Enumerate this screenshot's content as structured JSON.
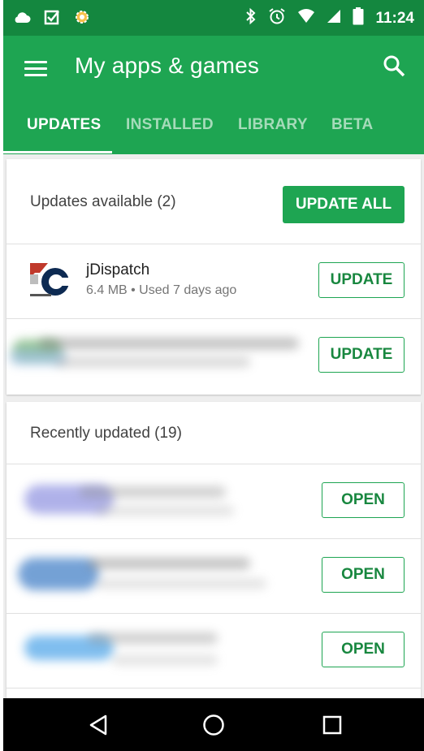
{
  "status_bar": {
    "time": "11:24",
    "battery_level": "90",
    "left_icons": [
      "cloud-icon",
      "checkbox-icon",
      "tasker-icon"
    ],
    "right_icons": [
      "bluetooth-icon",
      "alarm-icon",
      "wifi-icon",
      "signal-icon",
      "battery-icon"
    ]
  },
  "app_bar": {
    "title": "My apps & games",
    "menu_icon": "menu-icon",
    "search_icon": "search-icon",
    "color": "#1ea552",
    "status_color": "#14873f"
  },
  "tabs": [
    {
      "label": "UPDATES",
      "active": true
    },
    {
      "label": "INSTALLED",
      "active": false
    },
    {
      "label": "LIBRARY",
      "active": false
    },
    {
      "label": "BETA",
      "active": false
    }
  ],
  "updates_card": {
    "title": "Updates available (2)",
    "update_all_label": "UPDATE ALL",
    "apps": [
      {
        "name": "jDispatch",
        "meta": "6.4 MB • Used 7 days ago",
        "button": "UPDATE"
      },
      {
        "name": "",
        "meta": "",
        "button": "UPDATE"
      }
    ]
  },
  "recent_card": {
    "title": "Recently updated (19)",
    "apps": [
      {
        "button": "OPEN"
      },
      {
        "button": "OPEN"
      },
      {
        "button": "OPEN"
      }
    ]
  },
  "nav_bar": {
    "icons": [
      "back-icon",
      "home-icon",
      "recents-icon"
    ]
  }
}
